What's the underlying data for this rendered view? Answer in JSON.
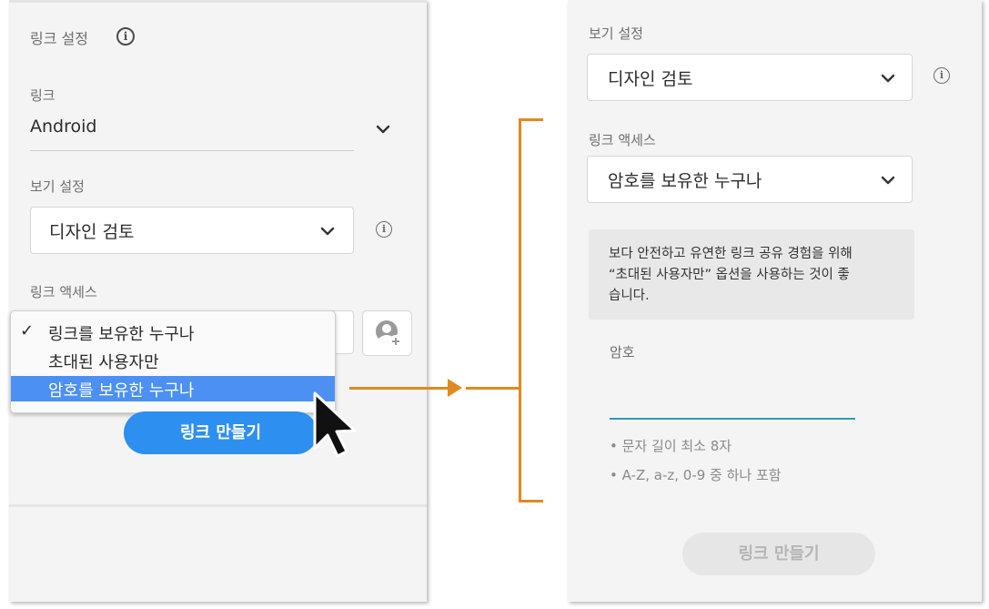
{
  "left": {
    "link_settings_title": "링크 설정",
    "link_label": "링크",
    "link_value": "Android",
    "view_settings_label": "보기 설정",
    "view_settings_value": "디자인 검토",
    "link_access_label": "링크 액세스",
    "access_options": [
      {
        "label": "링크를 보유한 누구나",
        "checked": true,
        "highlighted": false
      },
      {
        "label": "초대된 사용자만",
        "checked": false,
        "highlighted": false
      },
      {
        "label": "암호를 보유한 누구나",
        "checked": false,
        "highlighted": true
      }
    ],
    "check_mark": "✓",
    "create_button": "링크 만들기"
  },
  "right": {
    "view_settings_label": "보기 설정",
    "view_settings_value": "디자인 검토",
    "link_access_label": "링크 액세스",
    "link_access_value": "암호를 보유한 누구나",
    "info_text": "보다 안전하고 유연한 링크 공유 경험을 위해 “초대된 사용자만” 옵션을 사용하는 것이 좋습니다.",
    "info_lines": [
      "보다 안전하고 유연한 링크 공유 경험을 위해",
      "“초대된 사용자만” 옵션을 사용하는 것이 좋",
      "습니다."
    ],
    "password_label": "암호",
    "password_value": "",
    "hints": [
      "• 문자 길이 최소 8자",
      "• A-Z, a-z, 0-9 중 하나 포함"
    ],
    "create_button": "링크 만들기",
    "create_button_enabled": false
  },
  "icons": {
    "info": "info-icon",
    "chevron": "chevron-down-icon",
    "add_user": "add-user-icon",
    "cursor": "mouse-cursor-icon"
  },
  "colors": {
    "accent_blue": "#2d8ff0",
    "highlight_blue": "#4b90f2",
    "connector_orange": "#e0891f",
    "input_underline": "#2d9bb8"
  }
}
